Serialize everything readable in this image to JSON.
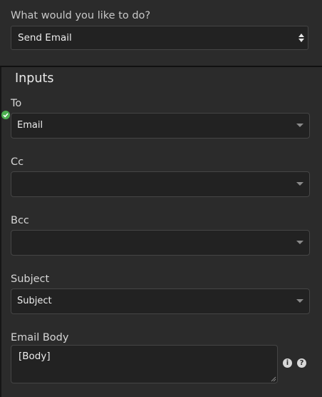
{
  "action": {
    "question": "What would you like to do?",
    "selected": "Send Email"
  },
  "inputs": {
    "title": "Inputs",
    "fields": [
      {
        "label": "To",
        "value": "Email"
      },
      {
        "label": "Cc",
        "value": ""
      },
      {
        "label": "Bcc",
        "value": ""
      },
      {
        "label": "Subject",
        "value": "Subject"
      }
    ],
    "body": {
      "label": "Email Body",
      "value": "[Body]"
    }
  },
  "icons": {
    "valid": "check-circle-icon",
    "info": "info-icon",
    "help": "help-icon"
  },
  "colors": {
    "valid": "#4caf50"
  }
}
